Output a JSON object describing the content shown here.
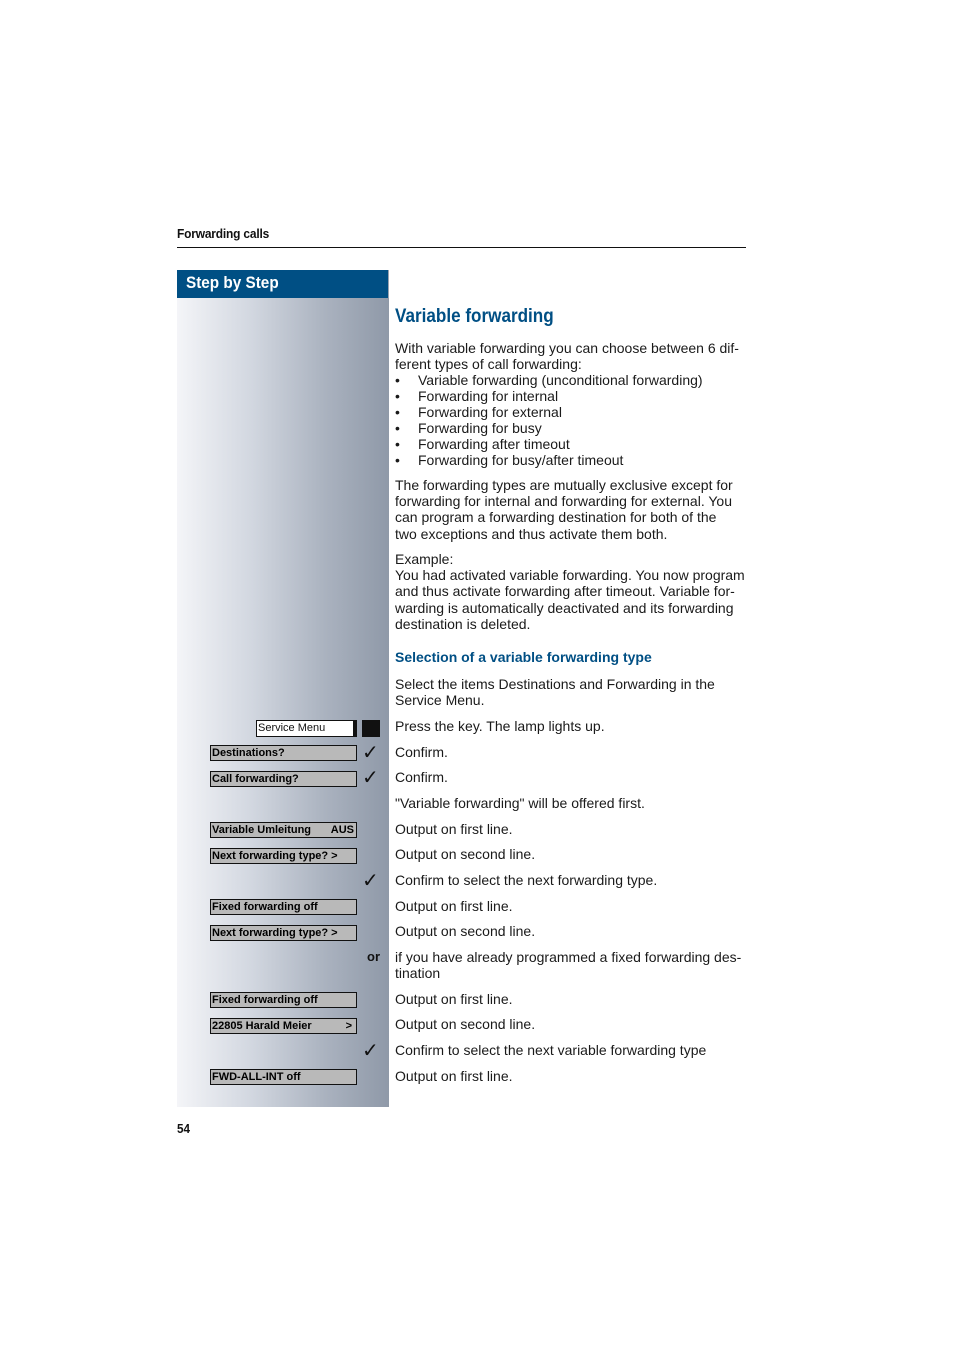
{
  "header": {
    "section_title": "Forwarding calls"
  },
  "sidebar": {
    "title": "Step by Step"
  },
  "main": {
    "title": "Variable forwarding",
    "intro_line1": "With variable forwarding you can choose between 6 dif-",
    "intro_line2": "ferent types of call forwarding:",
    "forwarding_types": [
      "Variable forwarding (unconditional forwarding)",
      "Forwarding for internal",
      "Forwarding for external",
      "Forwarding for busy",
      "Forwarding after timeout",
      "Forwarding for busy/after timeout"
    ],
    "exclusive_note": [
      "The forwarding types are mutually exclusive except for",
      "forwarding for internal and forwarding for external. You",
      "can program a forwarding destination for both of the",
      "two exceptions and thus activate them both."
    ],
    "example_label": "Example:",
    "example_text": [
      "You had activated variable forwarding. You now program",
      "and thus activate forwarding after timeout. Variable for-",
      "warding is automatically deactivated and its forwarding",
      "destination is deleted."
    ],
    "subtitle": "Selection of a variable forwarding type",
    "select_instruction": [
      "Select the items Destinations and Forwarding in the",
      "Service Menu."
    ]
  },
  "steps": {
    "service_menu_key": "Service Menu",
    "press_key": "Press the key. The lamp lights up.",
    "destinations_display": "Destinations?",
    "confirm1": "Confirm.",
    "call_forwarding_display": "Call forwarding?",
    "confirm2": "Confirm.",
    "offered_first": "\"Variable forwarding\" will be offered first.",
    "lcd_variable_umleitung": "Variable Umleitung",
    "lcd_variable_umleitung_status": "AUS",
    "output_first_1": "Output on first line.",
    "lcd_next_type_1": "Next forwarding type?  >",
    "output_second_1": "Output on second line.",
    "confirm_next": "Confirm to select the next forwarding type.",
    "lcd_fixed_off_1": "Fixed forwarding off",
    "output_first_2": "Output on first line.",
    "lcd_next_type_2": "Next forwarding type?  >",
    "output_second_2": "Output on second line.",
    "or_label": "or",
    "or_text": [
      "if you have already programmed a fixed forwarding des-",
      "tination"
    ],
    "lcd_fixed_off_2": "Fixed forwarding off",
    "output_first_3": "Output on first line.",
    "lcd_harald": "22805 Harald Meier",
    "lcd_harald_arrow": ">",
    "output_second_3": "Output on second line.",
    "confirm_next_variable": "Confirm to select the next variable forwarding type",
    "lcd_fwd_all_int": "FWD-ALL-INT off",
    "output_first_4": "Output on first line."
  },
  "footer": {
    "page_number": "54"
  }
}
